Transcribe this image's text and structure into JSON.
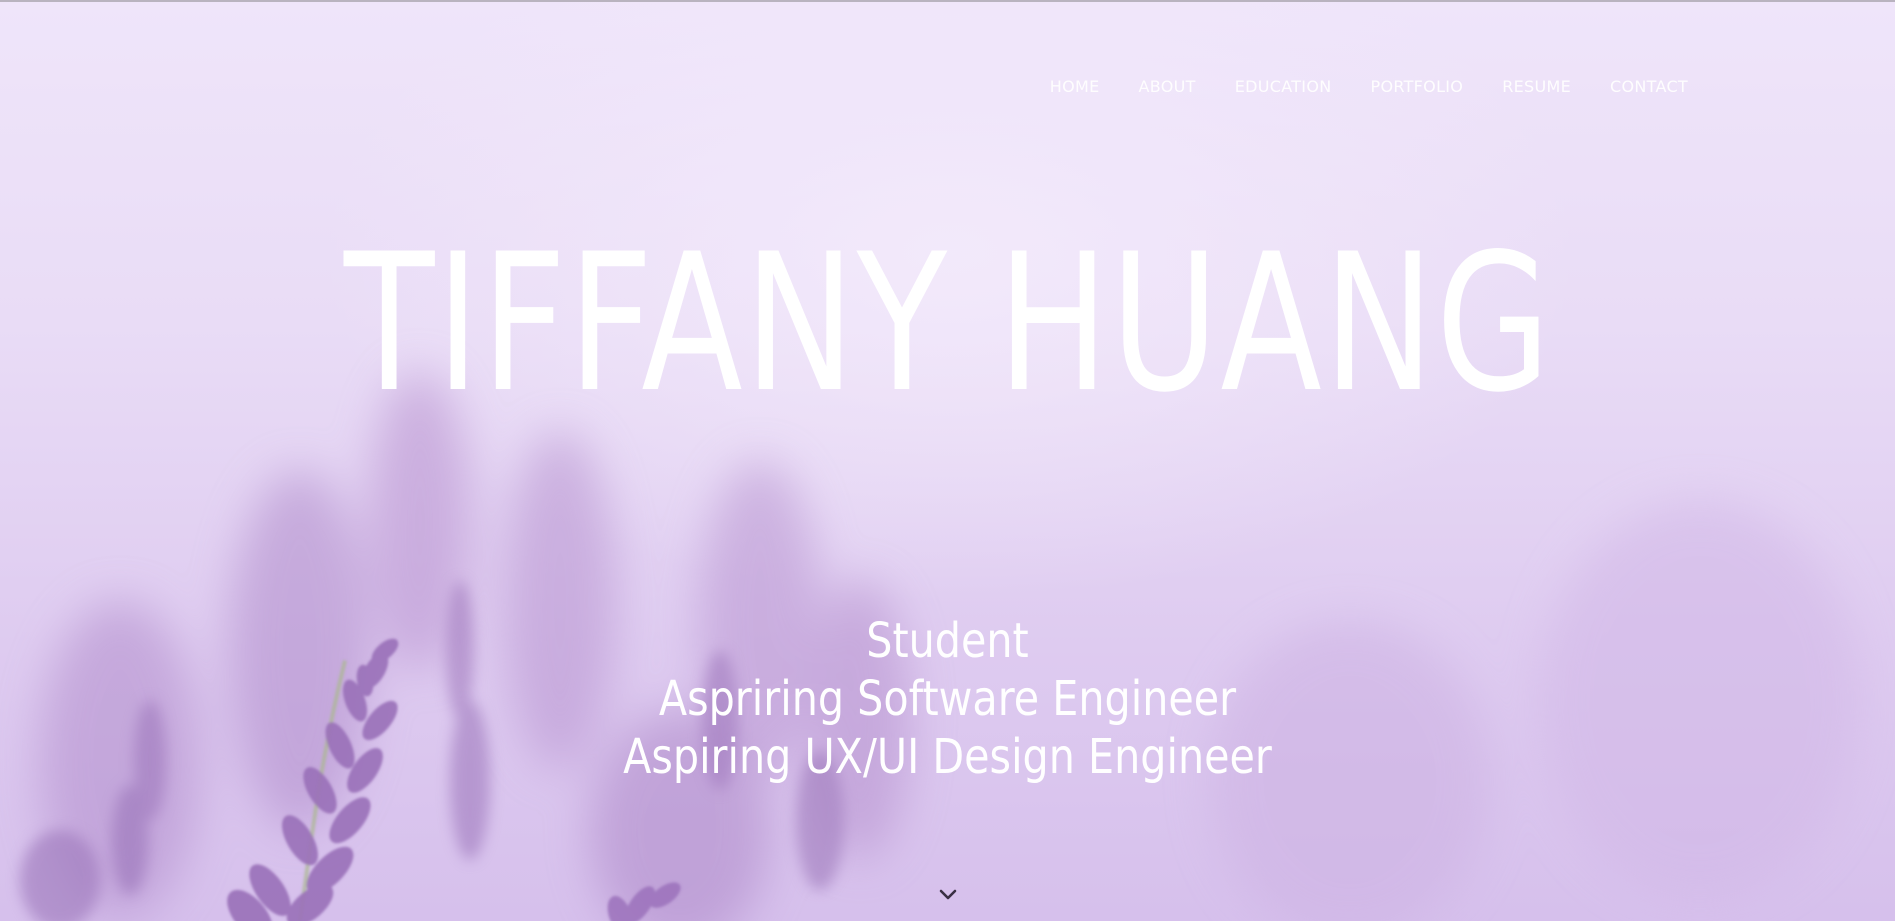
{
  "nav": {
    "items": [
      {
        "label": "HOME"
      },
      {
        "label": "ABOUT"
      },
      {
        "label": "EDUCATION"
      },
      {
        "label": "PORTFOLIO"
      },
      {
        "label": "RESUME"
      },
      {
        "label": "CONTACT"
      }
    ]
  },
  "hero": {
    "name": "TIFFANY HUANG",
    "roles": [
      "Student",
      "Aspriring Software Engineer",
      "Aspiring UX/UI Design Engineer"
    ]
  },
  "scroll_icon": "chevron-down-icon",
  "colors": {
    "background_light": "#efe5fa",
    "background_dark": "#d6c0ec",
    "lavender": "#9b74b8",
    "text": "#ffffff"
  }
}
